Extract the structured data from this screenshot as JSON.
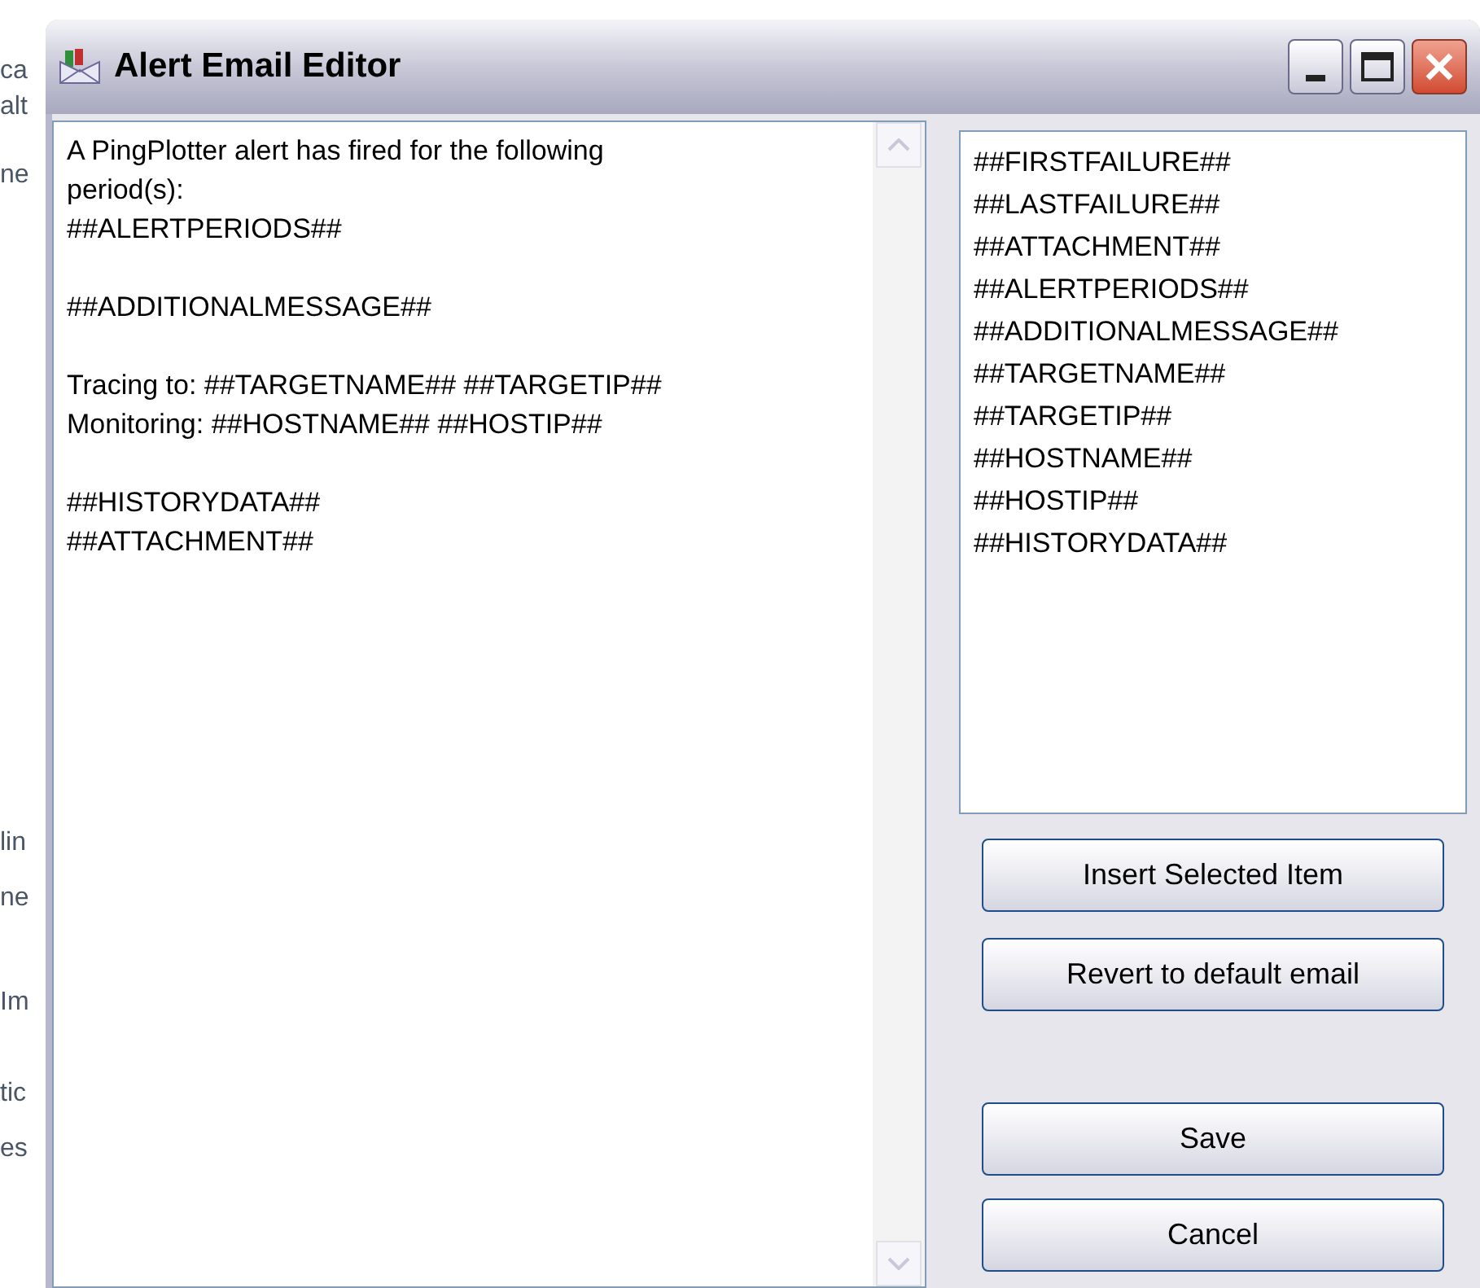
{
  "background_fragments": [
    "ca",
    "alt",
    "ne",
    "lin",
    "ne",
    "Im",
    "tic",
    "es"
  ],
  "window": {
    "title": "Alert Email Editor"
  },
  "editor": {
    "paragraphs": [
      [
        "A PingPlotter alert has fired for the following",
        "period(s):",
        "##ALERTPERIODS##"
      ],
      [
        "##ADDITIONALMESSAGE##"
      ],
      [
        "Tracing to: ##TARGETNAME## ##TARGETIP##",
        "Monitoring: ##HOSTNAME## ##HOSTIP##"
      ],
      [
        "##HISTORYDATA##",
        "##ATTACHMENT##"
      ]
    ]
  },
  "variables": [
    "##FIRSTFAILURE##",
    "##LASTFAILURE##",
    "##ATTACHMENT##",
    "##ALERTPERIODS##",
    "##ADDITIONALMESSAGE##",
    "##TARGETNAME##",
    "##TARGETIP##",
    "##HOSTNAME##",
    "##HOSTIP##",
    "##HISTORYDATA##"
  ],
  "buttons": [
    {
      "label": "Insert Selected Item",
      "kind": "action"
    },
    {
      "label": "Revert to default email",
      "kind": "action"
    },
    {
      "label": "Save",
      "kind": "dialog"
    },
    {
      "label": "Cancel",
      "kind": "dialog"
    }
  ]
}
